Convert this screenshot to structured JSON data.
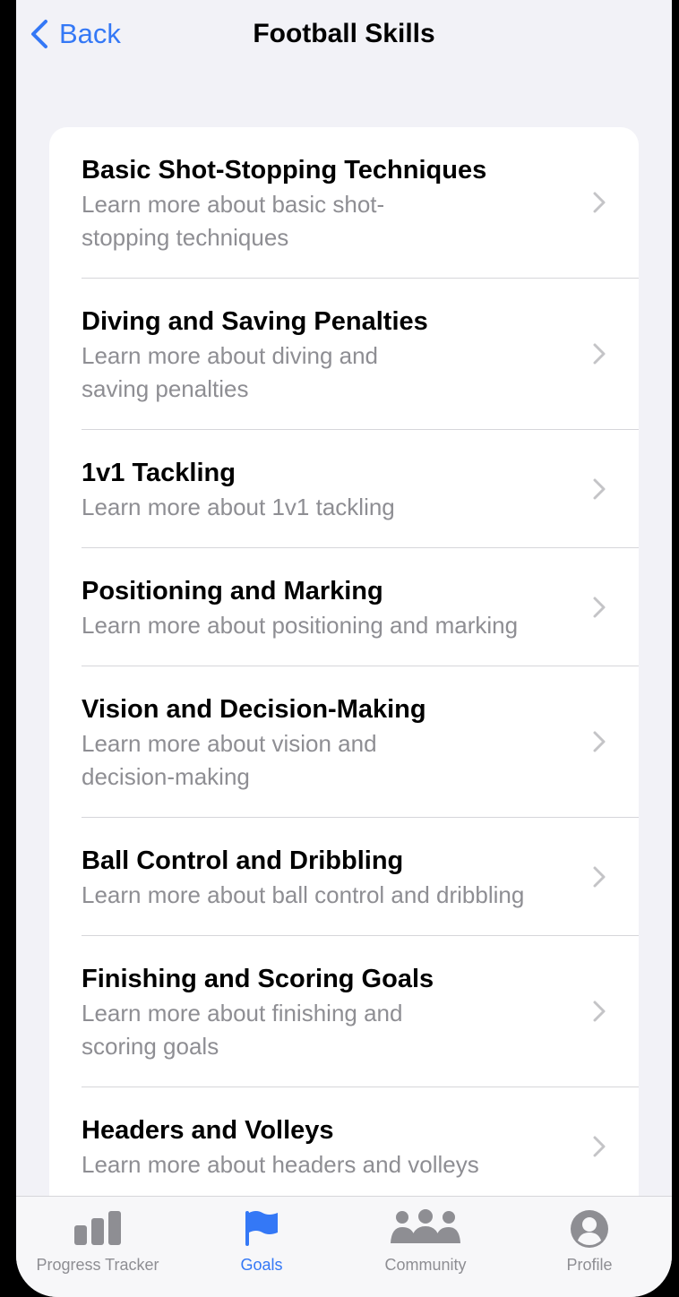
{
  "nav": {
    "back_label": "Back",
    "title": "Football Skills"
  },
  "skills": [
    {
      "title": "Basic Shot-Stopping Techniques",
      "subtitle": "Learn more about basic shot-\nstopping techniques"
    },
    {
      "title": "Diving and Saving Penalties",
      "subtitle": "Learn more about diving and\nsaving penalties"
    },
    {
      "title": "1v1 Tackling",
      "subtitle": "Learn more about 1v1 tackling"
    },
    {
      "title": "Positioning and Marking",
      "subtitle": "Learn more about positioning and marking"
    },
    {
      "title": "Vision and Decision-Making",
      "subtitle": "Learn more about vision and\ndecision-making"
    },
    {
      "title": "Ball Control and Dribbling",
      "subtitle": "Learn more about ball control and dribbling"
    },
    {
      "title": "Finishing and Scoring Goals",
      "subtitle": "Learn more about finishing and\nscoring goals"
    },
    {
      "title": "Headers and Volleys",
      "subtitle": "Learn more about headers and volleys"
    }
  ],
  "tabbar": {
    "tabs": [
      {
        "label": "Progress Tracker",
        "icon": "bar-chart-icon",
        "active": false
      },
      {
        "label": "Goals",
        "icon": "flag-icon",
        "active": true
      },
      {
        "label": "Community",
        "icon": "people-icon",
        "active": false
      },
      {
        "label": "Profile",
        "icon": "person-circle-icon",
        "active": false
      }
    ]
  },
  "colors": {
    "accent": "#3478f6",
    "secondary_text": "#8e8e93",
    "background": "#f2f2f7"
  }
}
